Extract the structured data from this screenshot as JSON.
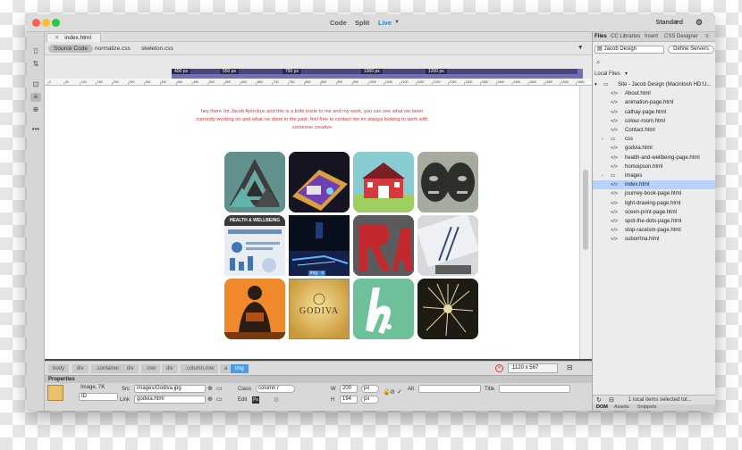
{
  "window": {
    "view_modes": [
      "Code",
      "Split",
      "Live"
    ],
    "workspace": "Standard"
  },
  "document_tab": "index.html",
  "related_files": [
    "Source Code",
    "normalize.css",
    "skeleton.css"
  ],
  "media_queries": [
    "400 px",
    "550 px",
    "750 px",
    "1000 px",
    "1200 px"
  ],
  "ruler_ticks": [
    "0",
    "50",
    "100",
    "150",
    "200",
    "250",
    "300",
    "350",
    "400",
    "450",
    "500",
    "550",
    "600",
    "650",
    "700",
    "750",
    "800",
    "850",
    "900",
    "950",
    "1000",
    "1050",
    "1100",
    "1150",
    "1200",
    "1250",
    "1300",
    "1350",
    "1400",
    "1450",
    "1500",
    "1550",
    "1600",
    "1650"
  ],
  "page_intro": [
    "hey there i'm Jacob Antrobus and this is a brife insite to me and my work, you can see what ive been",
    "currently working on and what ive done in the past. feel free to contact me im always looking to work with",
    "someone creative"
  ],
  "image_tag": "img",
  "tag_selector": [
    "body",
    "div",
    ".container",
    "div",
    ".row",
    "div",
    ".column.row",
    "a",
    "img"
  ],
  "viewport_size": "1120 x 567",
  "properties": {
    "header": "Properties",
    "type": "Image, 7K",
    "id_label": "ID",
    "src_label": "Src",
    "src_value": "images/Godiva.jpg",
    "link_label": "Link",
    "link_value": "godvia.html",
    "class_label": "Class",
    "class_value": "column r",
    "edit_label": "Edit",
    "w_label": "W",
    "w_value": "200",
    "w_unit": "px",
    "h_label": "H",
    "h_value": "194",
    "h_unit": "px",
    "alt_label": "Alt",
    "title_label": "Title"
  },
  "panel": {
    "tabs": [
      "Files",
      "CC Libraries",
      "Insert",
      "CSS Designer"
    ],
    "site_select": "Jacob Design",
    "define_servers": "Define Servers",
    "local_files_label": "Local Files",
    "status": "1 local items selected tot...",
    "bottom_tabs": [
      "DOM",
      "Assets",
      "Snippets"
    ],
    "files": [
      {
        "name": "Site - Jacob Design (Macintosh HD:U...",
        "kind": "site"
      },
      {
        "name": "About.html",
        "kind": "html"
      },
      {
        "name": "animation-page.html",
        "kind": "html"
      },
      {
        "name": "cathay-page.html",
        "kind": "html"
      },
      {
        "name": "colour-room.html",
        "kind": "html"
      },
      {
        "name": "Contact.html",
        "kind": "html"
      },
      {
        "name": "css",
        "kind": "folder"
      },
      {
        "name": "godvia.html",
        "kind": "html"
      },
      {
        "name": "health-and-wellbeing-page.html",
        "kind": "html"
      },
      {
        "name": "homoipson.html",
        "kind": "html"
      },
      {
        "name": "images",
        "kind": "folder"
      },
      {
        "name": "index.html",
        "kind": "html"
      },
      {
        "name": "journey-book-page.html",
        "kind": "html"
      },
      {
        "name": "light-drawing-page.html",
        "kind": "html"
      },
      {
        "name": "sceen-print-page.html",
        "kind": "html"
      },
      {
        "name": "spot-the-dots-page.html",
        "kind": "html"
      },
      {
        "name": "stop-raceism-page.html",
        "kind": "html"
      },
      {
        "name": "suborrtna.html",
        "kind": "html"
      }
    ]
  },
  "tiles": [
    {
      "name": "triangle-art",
      "text": ""
    },
    {
      "name": "book-photo",
      "text": ""
    },
    {
      "name": "barn-illustration",
      "text": ""
    },
    {
      "name": "faces-print",
      "text": ""
    },
    {
      "name": "health-wellbeing-poster",
      "text": "HEALTH & WELLBEING"
    },
    {
      "name": "light-drawing",
      "text": ""
    },
    {
      "name": "red-lettering",
      "text": ""
    },
    {
      "name": "screen-print",
      "text": ""
    },
    {
      "name": "reading-figure",
      "text": ""
    },
    {
      "name": "godiva-logo",
      "text": "GODIVA"
    },
    {
      "name": "green-h-logo",
      "text": ""
    },
    {
      "name": "dandelion-print",
      "text": ""
    }
  ]
}
